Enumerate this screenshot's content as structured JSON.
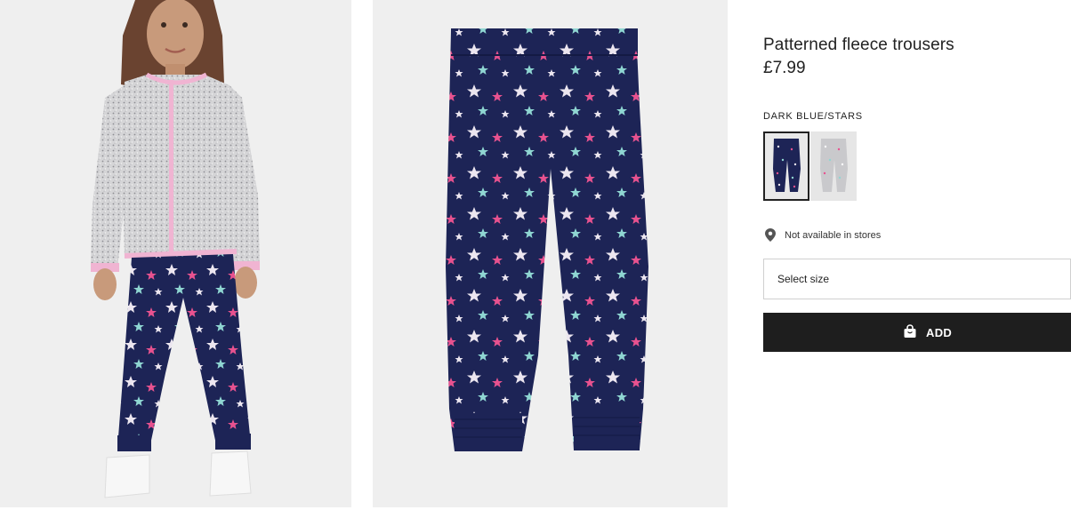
{
  "product": {
    "title": "Patterned fleece trousers",
    "price": "£7.99",
    "colour_name": "DARK BLUE/STARS"
  },
  "swatches": [
    {
      "name": "Dark blue/stars",
      "selected": true,
      "color": "#1d2456"
    },
    {
      "name": "Light grey/stars",
      "selected": false,
      "color": "#c9c9cc"
    }
  ],
  "availability": {
    "icon": "location-pin-icon",
    "text": "Not available in stores"
  },
  "size_select": {
    "placeholder": "Select size"
  },
  "add_button": {
    "icon": "shopping-bag-icon",
    "label": "ADD"
  },
  "images": [
    {
      "name": "model-photo"
    },
    {
      "name": "product-photo"
    }
  ],
  "colors": {
    "trouser_navy": "#1d2456",
    "star_pink": "#e8528f",
    "star_aqua": "#8fd6d2",
    "star_white": "#ece6f0",
    "button_bg": "#1e1e1e",
    "photo_bg": "#efefef"
  }
}
